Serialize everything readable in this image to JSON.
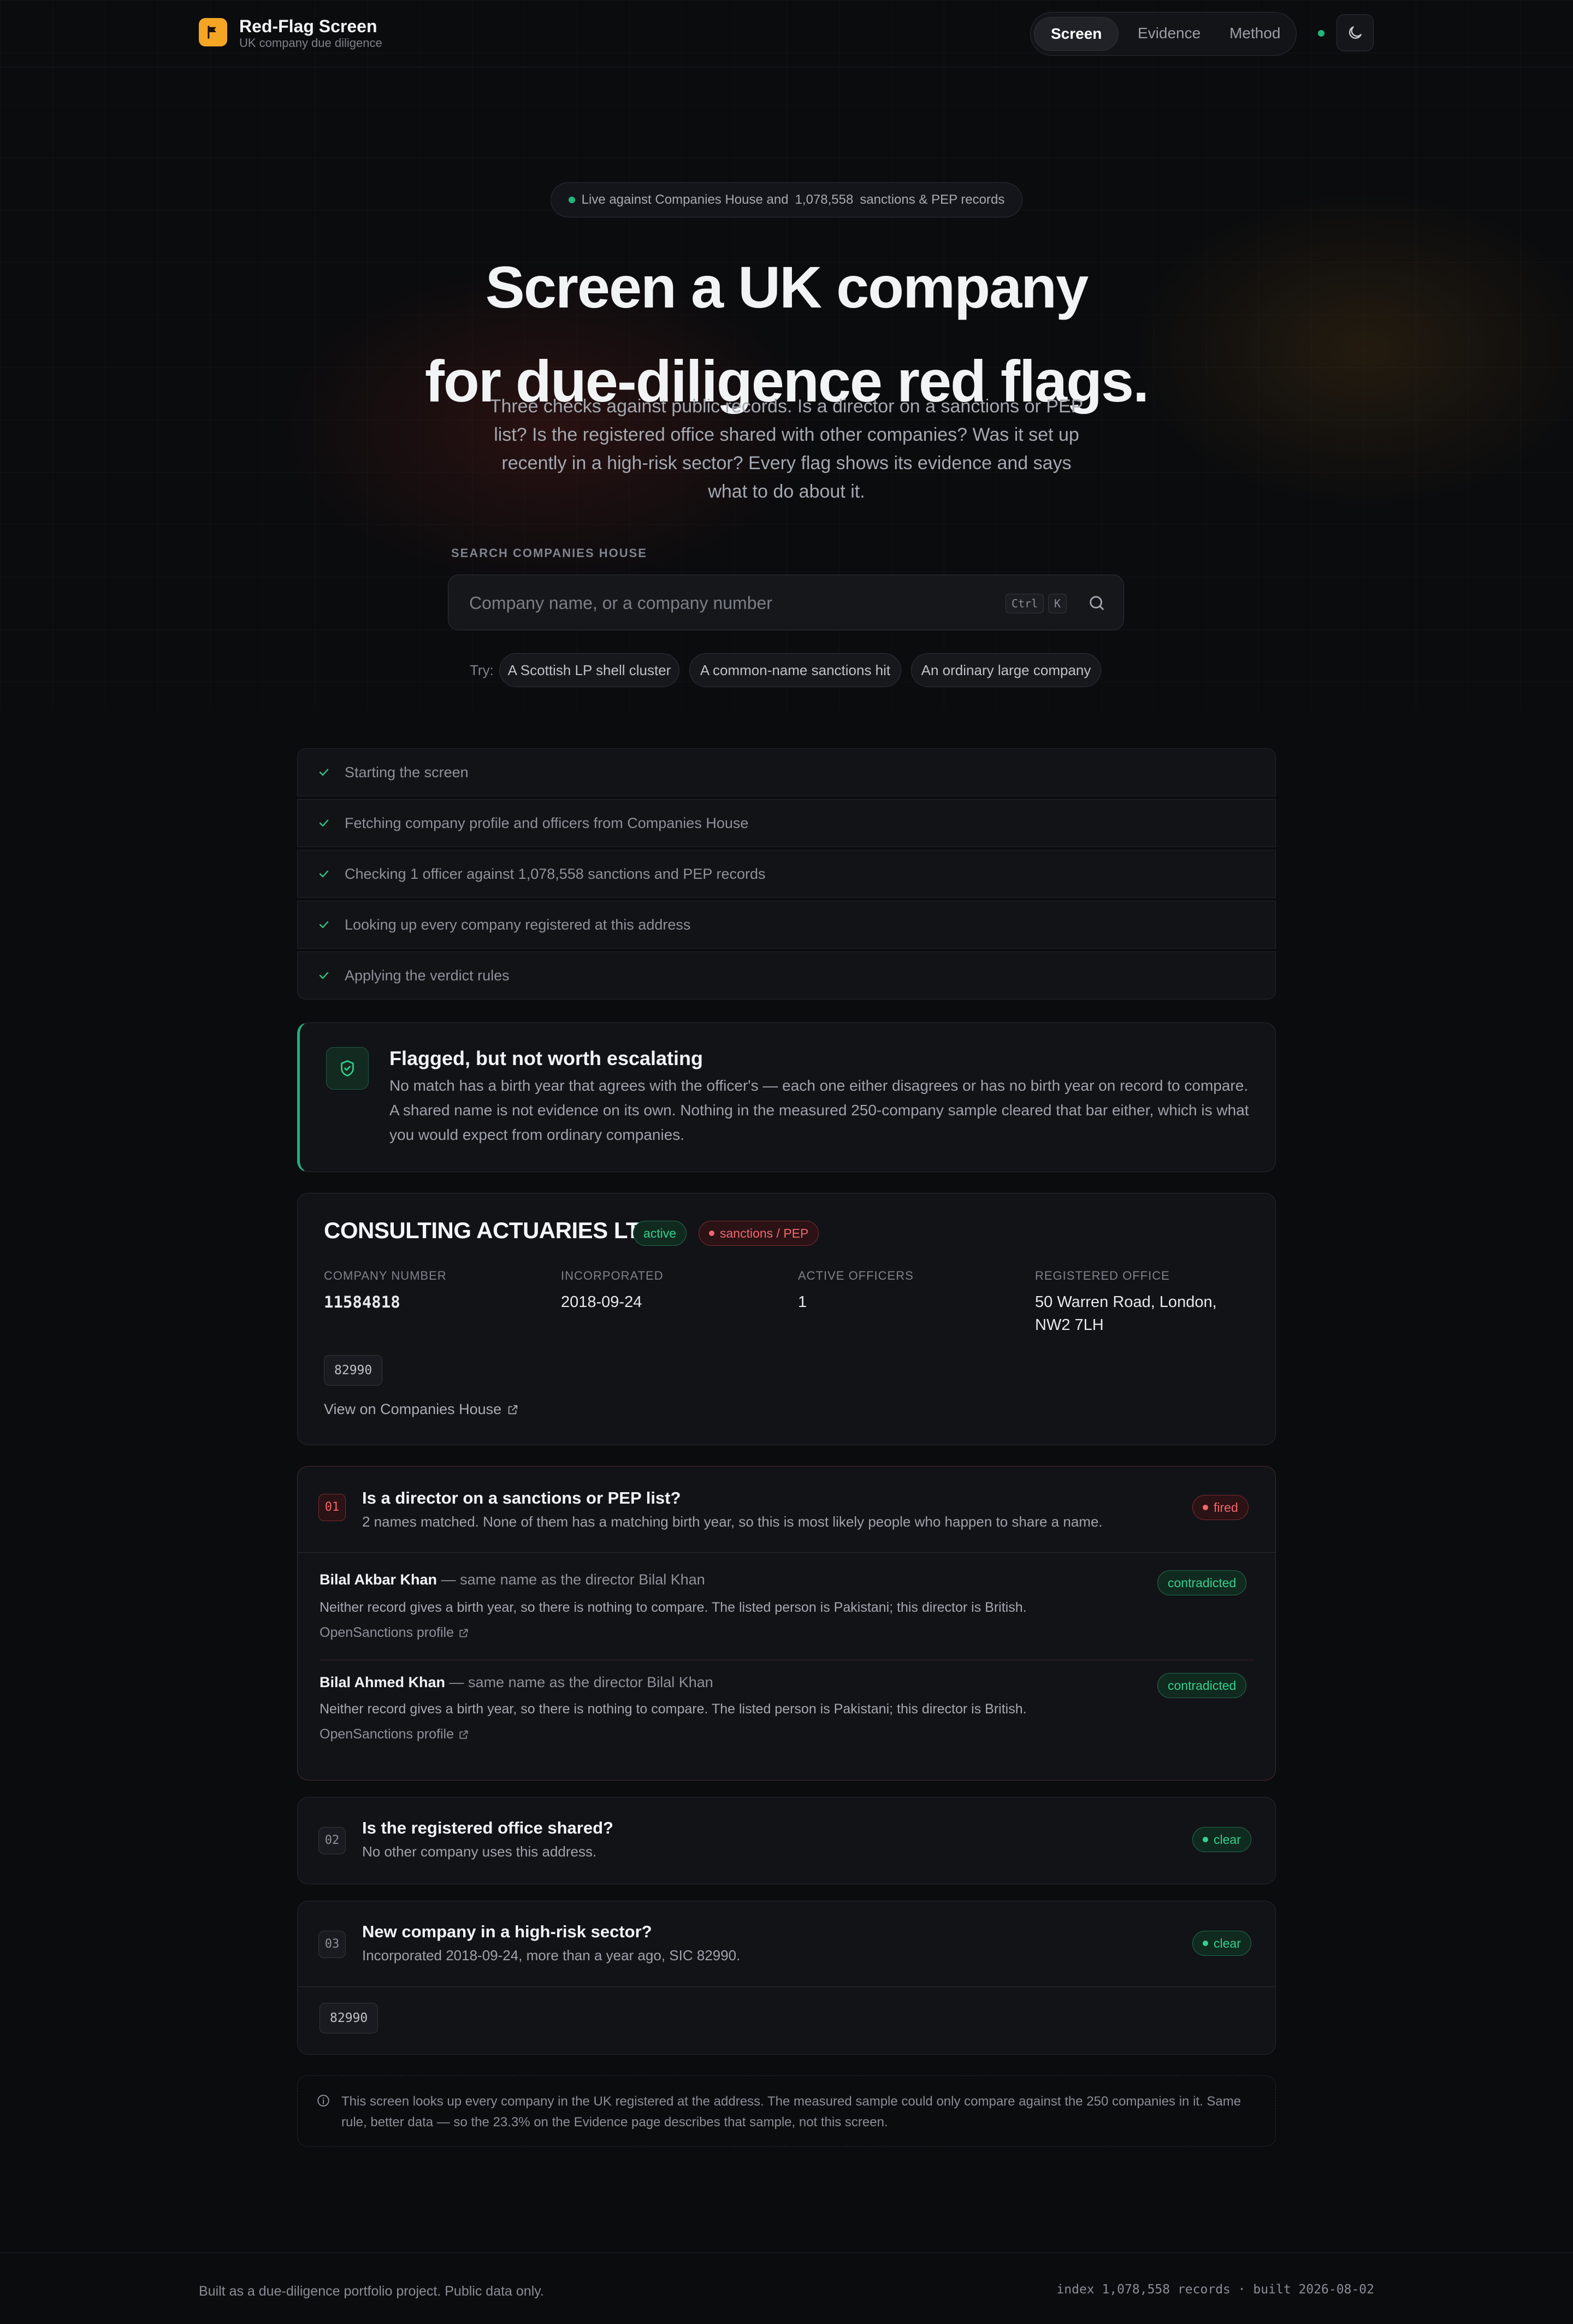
{
  "header": {
    "brand_title": "Red-Flag Screen",
    "brand_subtitle": "UK company due diligence",
    "nav": [
      "Screen",
      "Evidence",
      "Method"
    ],
    "active_nav": "Screen"
  },
  "hero": {
    "pill_prefix": "Live against Companies House and",
    "pill_count": "1,078,558",
    "pill_suffix": "sanctions & PEP records",
    "title_line1": "Screen a UK company",
    "title_line2": "for due-diligence red flags.",
    "subtitle": "Three checks against public records. Is a director on a sanctions or PEP list? Is the registered office shared with other companies? Was it set up recently in a high-risk sector? Every flag shows its evidence and says what to do about it."
  },
  "search": {
    "label": "SEARCH COMPANIES HOUSE",
    "placeholder": "Company name, or a company number",
    "kbd_ctrl": "Ctrl",
    "kbd_k": "K",
    "try_label": "Try:",
    "suggestions": [
      "A Scottish LP shell cluster",
      "A common-name sanctions hit",
      "An ordinary large company"
    ]
  },
  "steps": [
    "Starting the screen",
    "Fetching company profile and officers from Companies House",
    "Checking 1 officer against 1,078,558 sanctions and PEP records",
    "Looking up every company registered at this address",
    "Applying the verdict rules"
  ],
  "verdict": {
    "title": "Flagged, but not worth escalating",
    "body": "No match has a birth year that agrees with the officer's — each one either disagrees or has no birth year on record to compare. A shared name is not evidence on its own. Nothing in the measured 250-company sample cleared that bar either, which is what you would expect from ordinary companies."
  },
  "company": {
    "name": "CONSULTING ACTUARIES LTD",
    "status_badge": "active",
    "flag_badge": "sanctions / PEP",
    "fields": {
      "number_label": "COMPANY NUMBER",
      "number": "11584818",
      "incorporated_label": "INCORPORATED",
      "incorporated": "2018-09-24",
      "officers_label": "ACTIVE OFFICERS",
      "officers": "1",
      "office_label": "REGISTERED OFFICE",
      "office": "50 Warren Road, London, NW2 7LH"
    },
    "sic": "82990",
    "link": "View on Companies House"
  },
  "checks": [
    {
      "num": "01",
      "title": "Is a director on a sanctions or PEP list?",
      "subtitle": "2 names matched. None of them has a matching birth year, so this is most likely people who happen to share a name.",
      "status": "fired",
      "matches": [
        {
          "name": "Bilal Akbar Khan",
          "relation": "— same name as the director Bilal Khan",
          "note": "Neither record gives a birth year, so there is nothing to compare. The listed person is Pakistani; this director is British.",
          "link": "OpenSanctions profile",
          "badge": "contradicted"
        },
        {
          "name": "Bilal Ahmed Khan",
          "relation": "— same name as the director Bilal Khan",
          "note": "Neither record gives a birth year, so there is nothing to compare. The listed person is Pakistani; this director is British.",
          "link": "OpenSanctions profile",
          "badge": "contradicted"
        }
      ]
    },
    {
      "num": "02",
      "title": "Is the registered office shared?",
      "subtitle": "No other company uses this address.",
      "status": "clear"
    },
    {
      "num": "03",
      "title": "New company in a high-risk sector?",
      "subtitle": "Incorporated 2018-09-24, more than a year ago, SIC 82990.",
      "status": "clear",
      "sic": "82990"
    }
  ],
  "note": "This screen looks up every company in the UK registered at the address. The measured sample could only compare against the 250 companies in it. Same rule, better data — so the 23.3% on the Evidence page describes that sample, not this screen.",
  "footer": {
    "left": "Built as a due-diligence portfolio project. Public data only.",
    "right": "index 1,078,558 records · built 2026-08-02"
  },
  "colors": {
    "accent_amber": "#f5a524",
    "green": "#35d08e",
    "red": "#f0686d",
    "background": "#0b0c0e"
  },
  "icons": [
    "flag-icon",
    "moon-icon",
    "search-icon",
    "check-icon",
    "shield-check-icon",
    "external-link-icon",
    "info-icon"
  ]
}
